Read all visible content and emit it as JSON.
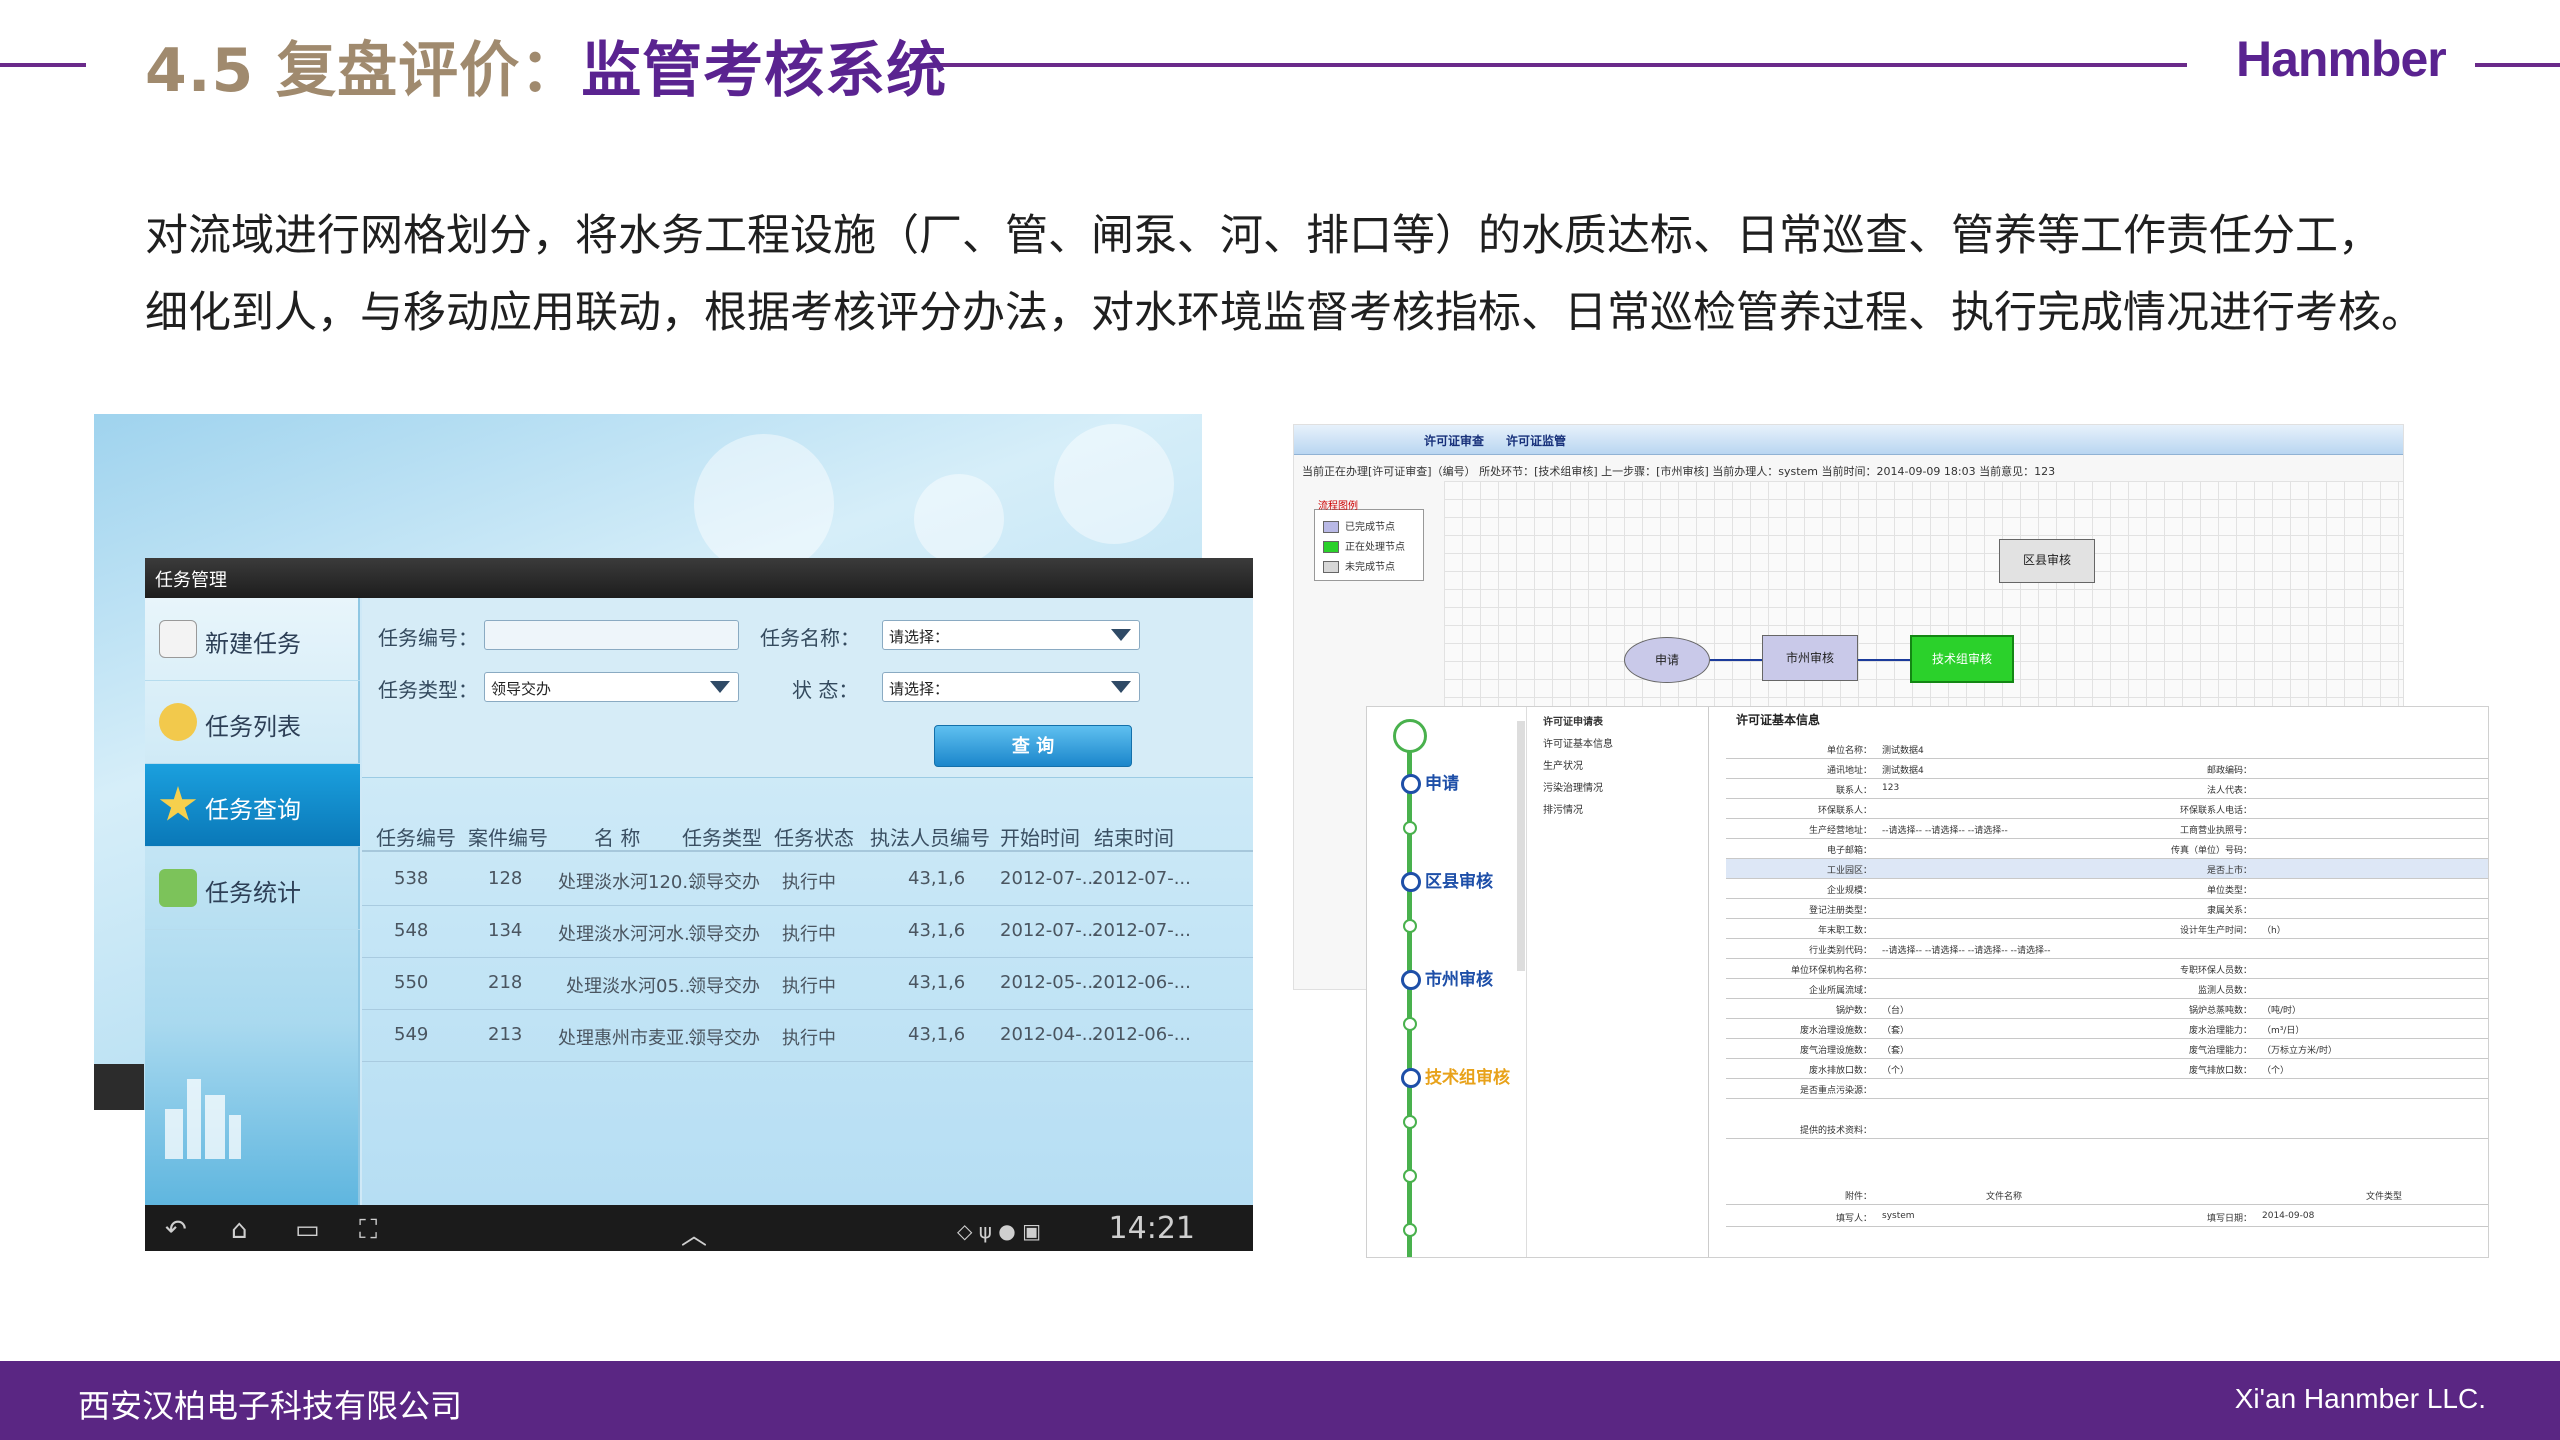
{
  "header": {
    "title_num": "4.5 复盘评价：",
    "title_main": "监管考核系统",
    "brand": "Hanmber"
  },
  "intro": {
    "line1": "对流域进行网格划分，将水务工程设施（厂、管、闸泵、河、排口等）的水质达标、日常巡查、管养等工作责任分工，",
    "line2": "细化到人，与移动应用联动，根据考核评分办法，对水环境监督考核指标、日常巡检管养过程、执行完成情况进行考核。"
  },
  "tablet": {
    "window_title": "任务管理",
    "side_items": [
      {
        "label": "新建任务",
        "icon": "edit-icon"
      },
      {
        "label": "任务列表",
        "icon": "list-icon"
      },
      {
        "label": "任务查询",
        "icon": "star-icon"
      },
      {
        "label": "任务统计",
        "icon": "chart-icon"
      }
    ],
    "filters": {
      "task_no_label": "任务编号：",
      "task_name_label": "任务名称：",
      "task_name_value": "请选择：",
      "task_type_label": "任务类型：",
      "task_type_value": "领导交办",
      "status_label": "状 态：",
      "status_value": "请选择：",
      "query_button": "查 询"
    },
    "columns": [
      "任务编号",
      "案件编号",
      "名 称",
      "任务类型",
      "任务状态",
      "执法人员编号",
      "开始时间",
      "结束时间"
    ],
    "rows": [
      [
        "538",
        "128",
        "处理淡水河120...",
        "领导交办",
        "执行中",
        "43,1,6",
        "2012-07-...",
        "2012-07-..."
      ],
      [
        "548",
        "134",
        "处理淡水河河水...",
        "领导交办",
        "执行中",
        "43,1,6",
        "2012-07-...",
        "2012-07-..."
      ],
      [
        "550",
        "218",
        "处理淡水河05...",
        "领导交办",
        "执行中",
        "43,1,6",
        "2012-05-...",
        "2012-06-..."
      ],
      [
        "549",
        "213",
        "处理惠州市麦亚...",
        "领导交办",
        "执行中",
        "43,1,6",
        "2012-04-...",
        "2012-06-..."
      ]
    ],
    "clock": "14:21"
  },
  "workflow": {
    "tabs": [
      "许可证审查",
      "许可证监管"
    ],
    "info": "当前正在办理[许可证审查]（编号）  所处环节：[技术组审核]  上一步骤：[市州审核]  当前办理人：system  当前时间：2014-09-09 18:03  当前意见：123",
    "legend_title": "流程图例",
    "legend_items": [
      {
        "label": "已完成节点",
        "color": "#b9b9e6"
      },
      {
        "label": "正在处理节点",
        "color": "#2bd12b"
      },
      {
        "label": "未完成节点",
        "color": "#d7d7d7"
      }
    ],
    "nodes": {
      "apply": "申请",
      "city": "市州审核",
      "tech": "技术组审核",
      "district": "区县审核"
    }
  },
  "form": {
    "steps": [
      {
        "label": "申请"
      },
      {
        "label": "区县审核"
      },
      {
        "label": "市州审核"
      },
      {
        "label": "技术组审核"
      }
    ],
    "tree_items": [
      "许可证申请表",
      "许可证基本信息",
      "生产状况",
      "污染治理情况",
      "排污情况"
    ],
    "detail_title": "许可证基本信息",
    "rows": [
      {
        "k": "单位名称：",
        "v": "测试数据4",
        "k2": "",
        "v2": ""
      },
      {
        "k": "通讯地址：",
        "v": "测试数据4",
        "k2": "邮政编码：",
        "v2": ""
      },
      {
        "k": "联系人：",
        "v": "123",
        "k2": "法人代表：",
        "v2": ""
      },
      {
        "k": "环保联系人：",
        "v": "",
        "k2": "环保联系人电话：",
        "v2": ""
      },
      {
        "k": "生产经营地址：",
        "v": "--请选择-- --请选择-- --请选择--",
        "k2": "工商营业执照号：",
        "v2": ""
      },
      {
        "k": "电子邮箱：",
        "v": "",
        "k2": "传真（单位）号码：",
        "v2": ""
      },
      {
        "k": "工业园区：",
        "v": "",
        "k2": "是否上市：",
        "v2": ""
      },
      {
        "k": "企业规模：",
        "v": "",
        "k2": "单位类型：",
        "v2": ""
      },
      {
        "k": "登记注册类型：",
        "v": "",
        "k2": "隶属关系：",
        "v2": ""
      },
      {
        "k": "年末职工数：",
        "v": "",
        "k2": "设计年生产时间：",
        "v2": "（h）"
      },
      {
        "k": "行业类别代码：",
        "v": "--请选择-- --请选择-- --请选择-- --请选择--",
        "k2": "",
        "v2": ""
      },
      {
        "k": "单位环保机构名称：",
        "v": "",
        "k2": "专职环保人员数：",
        "v2": ""
      },
      {
        "k": "企业所属流域：",
        "v": "",
        "k2": "监测人员数：",
        "v2": ""
      },
      {
        "k": "锅炉数：",
        "v": "（台）",
        "k2": "锅炉总蒸吨数：",
        "v2": "（吨/时）"
      },
      {
        "k": "废水治理设施数：",
        "v": "（套）",
        "k2": "废水治理能力：",
        "v2": "（m³/日）"
      },
      {
        "k": "废气治理设施数：",
        "v": "（套）",
        "k2": "废气治理能力：",
        "v2": "（万标立方米/时）"
      },
      {
        "k": "废水排放口数：",
        "v": "（个）",
        "k2": "废气排放口数：",
        "v2": "（个）"
      },
      {
        "k": "是否重点污染源：",
        "v": "",
        "k2": "",
        "v2": ""
      }
    ],
    "tail_rows": [
      {
        "k": "提供的技术资料：",
        "v": ""
      },
      {
        "k": "附件：",
        "v": "文件名称",
        "v2": "文件类型"
      },
      {
        "k": "填写人：",
        "v": "system",
        "k2": "填写日期：",
        "v2": "2014-09-08"
      }
    ]
  },
  "footer": {
    "company": "西安汉柏电子科技有限公司",
    "company_en": "Xi'an Hanmber LLC."
  }
}
